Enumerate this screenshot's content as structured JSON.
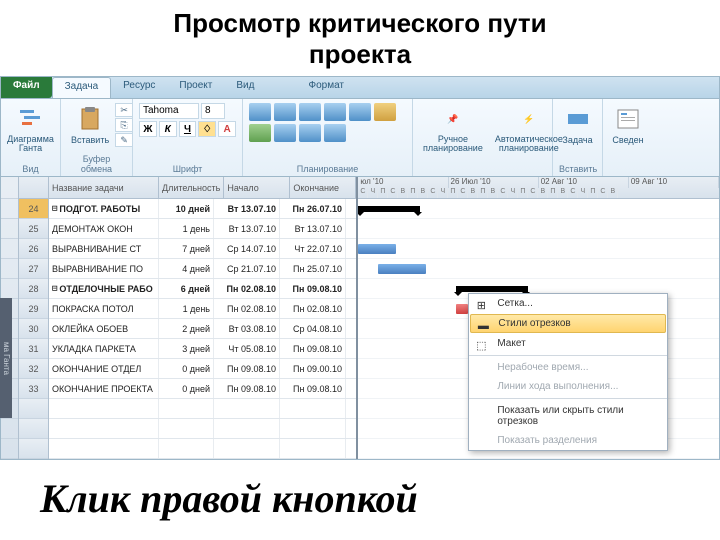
{
  "slide_title_l1": "Просмотр критического пути",
  "slide_title_l2": "проекта",
  "tabs": {
    "file": "Файл",
    "task": "Задача",
    "resource": "Ресурс",
    "project": "Проект",
    "view": "Вид",
    "format": "Формат"
  },
  "ribbon": {
    "view": {
      "gantt": "Диаграмма\nГанта",
      "label": "Вид"
    },
    "clip": {
      "paste": "Вставить",
      "label": "Буфер обмена"
    },
    "font": {
      "name": "Tahoma",
      "size": "8",
      "label": "Шрифт",
      "bold": "Ж",
      "italic": "К",
      "underline": "Ч"
    },
    "plan": {
      "label": "Планирование"
    },
    "mode": {
      "manual": "Ручное\nпланирование",
      "auto": "Автоматическое\nпланирование"
    },
    "insert": {
      "task": "Задача",
      "label": "Вставить"
    },
    "info": {
      "label": "Сведен"
    }
  },
  "columns": {
    "name": "Название задачи",
    "dur": "Длительность",
    "start": "Начало",
    "finish": "Окончание"
  },
  "weeks": [
    "юл '10",
    "26 Июл '10",
    "02 Авг '10",
    "09 Авг '10"
  ],
  "days": [
    "С",
    "Ч",
    "П",
    "С",
    "В",
    "П",
    "В",
    "С",
    "Ч",
    "П",
    "С",
    "В",
    "П",
    "В",
    "С",
    "Ч",
    "П",
    "С",
    "В",
    "П",
    "В",
    "С",
    "Ч",
    "П",
    "С",
    "В"
  ],
  "rows": [
    {
      "id": "24",
      "name": "ПОДГОТ. РАБОТЫ",
      "dur": "10 дней",
      "start": "Вт 13.07.10",
      "finish": "Пн 26.07.10",
      "bold": true,
      "summary": true
    },
    {
      "id": "25",
      "name": "ДЕМОНТАЖ ОКОН",
      "dur": "1 день",
      "start": "Вт 13.07.10",
      "finish": "Вт 13.07.10"
    },
    {
      "id": "26",
      "name": "ВЫРАВНИВАНИЕ СТ",
      "dur": "7 дней",
      "start": "Ср 14.07.10",
      "finish": "Чт 22.07.10"
    },
    {
      "id": "27",
      "name": "ВЫРАВНИВАНИЕ ПО",
      "dur": "4 дней",
      "start": "Ср 21.07.10",
      "finish": "Пн 25.07.10"
    },
    {
      "id": "28",
      "name": "ОТДЕЛОЧНЫЕ РАБО",
      "dur": "6 дней",
      "start": "Пн 02.08.10",
      "finish": "Пн 09.08.10",
      "bold": true,
      "summary": true
    },
    {
      "id": "29",
      "name": "ПОКРАСКА ПОТОЛ",
      "dur": "1 день",
      "start": "Пн 02.08.10",
      "finish": "Пн 02.08.10"
    },
    {
      "id": "30",
      "name": "ОКЛЕЙКА ОБОЕВ",
      "dur": "2 дней",
      "start": "Вт 03.08.10",
      "finish": "Ср 04.08.10"
    },
    {
      "id": "31",
      "name": "УКЛАДКА ПАРКЕТА",
      "dur": "3 дней",
      "start": "Чт 05.08.10",
      "finish": "Пн 09.08.10"
    },
    {
      "id": "32",
      "name": "ОКОНЧАНИЕ ОТДЕЛ",
      "dur": "0 дней",
      "start": "Пн 09.08.10",
      "finish": "Пн 09.00.10"
    },
    {
      "id": "33",
      "name": "ОКОНЧАНИЕ ПРОЕКТА",
      "dur": "0 дней",
      "start": "Пн 09.08.10",
      "finish": "Пн 09.08.10"
    }
  ],
  "context_menu": {
    "grid": "Сетка...",
    "barstyles": "Стили отрезков",
    "layout": "Макет",
    "nonwork": "Нерабочее время...",
    "progress": "Линии хода выполнения...",
    "showhide": "Показать или скрыть стили отрезков",
    "showsplit": "Показать разделения"
  },
  "vtab": "ма Ганта",
  "bottom_text": "Клик правой кнопкой"
}
